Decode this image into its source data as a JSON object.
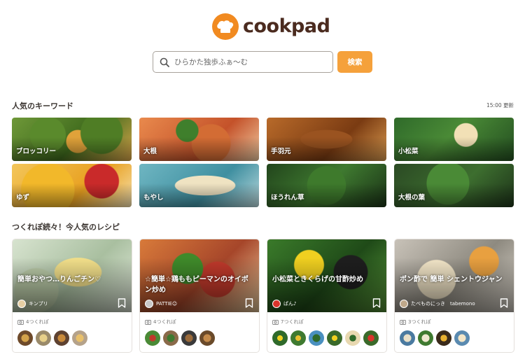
{
  "header": {
    "logo_text": "cookpad",
    "brand_color": "#f18a20"
  },
  "search": {
    "placeholder": "ひらかた独歩ふぁ～む",
    "button_label": "検索"
  },
  "keywords_section": {
    "title": "人気のキーワード",
    "updated": "15:00 更新",
    "items": [
      {
        "label": "ブロッコリー"
      },
      {
        "label": "大根"
      },
      {
        "label": "手羽元"
      },
      {
        "label": "小松菜"
      },
      {
        "label": "ゆず"
      },
      {
        "label": "もやし"
      },
      {
        "label": "ほうれん草"
      },
      {
        "label": "大根の葉"
      }
    ]
  },
  "recipes_section": {
    "title": "つくれぽ続々！今人気のレシピ",
    "cards": [
      {
        "title": "簡単おやつ…りんごチン♡",
        "author": "キンプリ",
        "tsukurepo": "4つくれぽ"
      },
      {
        "title": "☆簡単☆鶏ももピーマンのオイポン炒め",
        "author": "PATTIE☺",
        "tsukurepo": "4つくれぽ"
      },
      {
        "title": "小松菜ときくらげの甘酢炒め",
        "author": "ぱん♪",
        "tsukurepo": "7つくれぽ"
      },
      {
        "title": "ポン酢で 簡単 シェントウジャン",
        "author": "たべものにっき　tabemono",
        "tsukurepo": "3つくれぽ"
      }
    ]
  }
}
